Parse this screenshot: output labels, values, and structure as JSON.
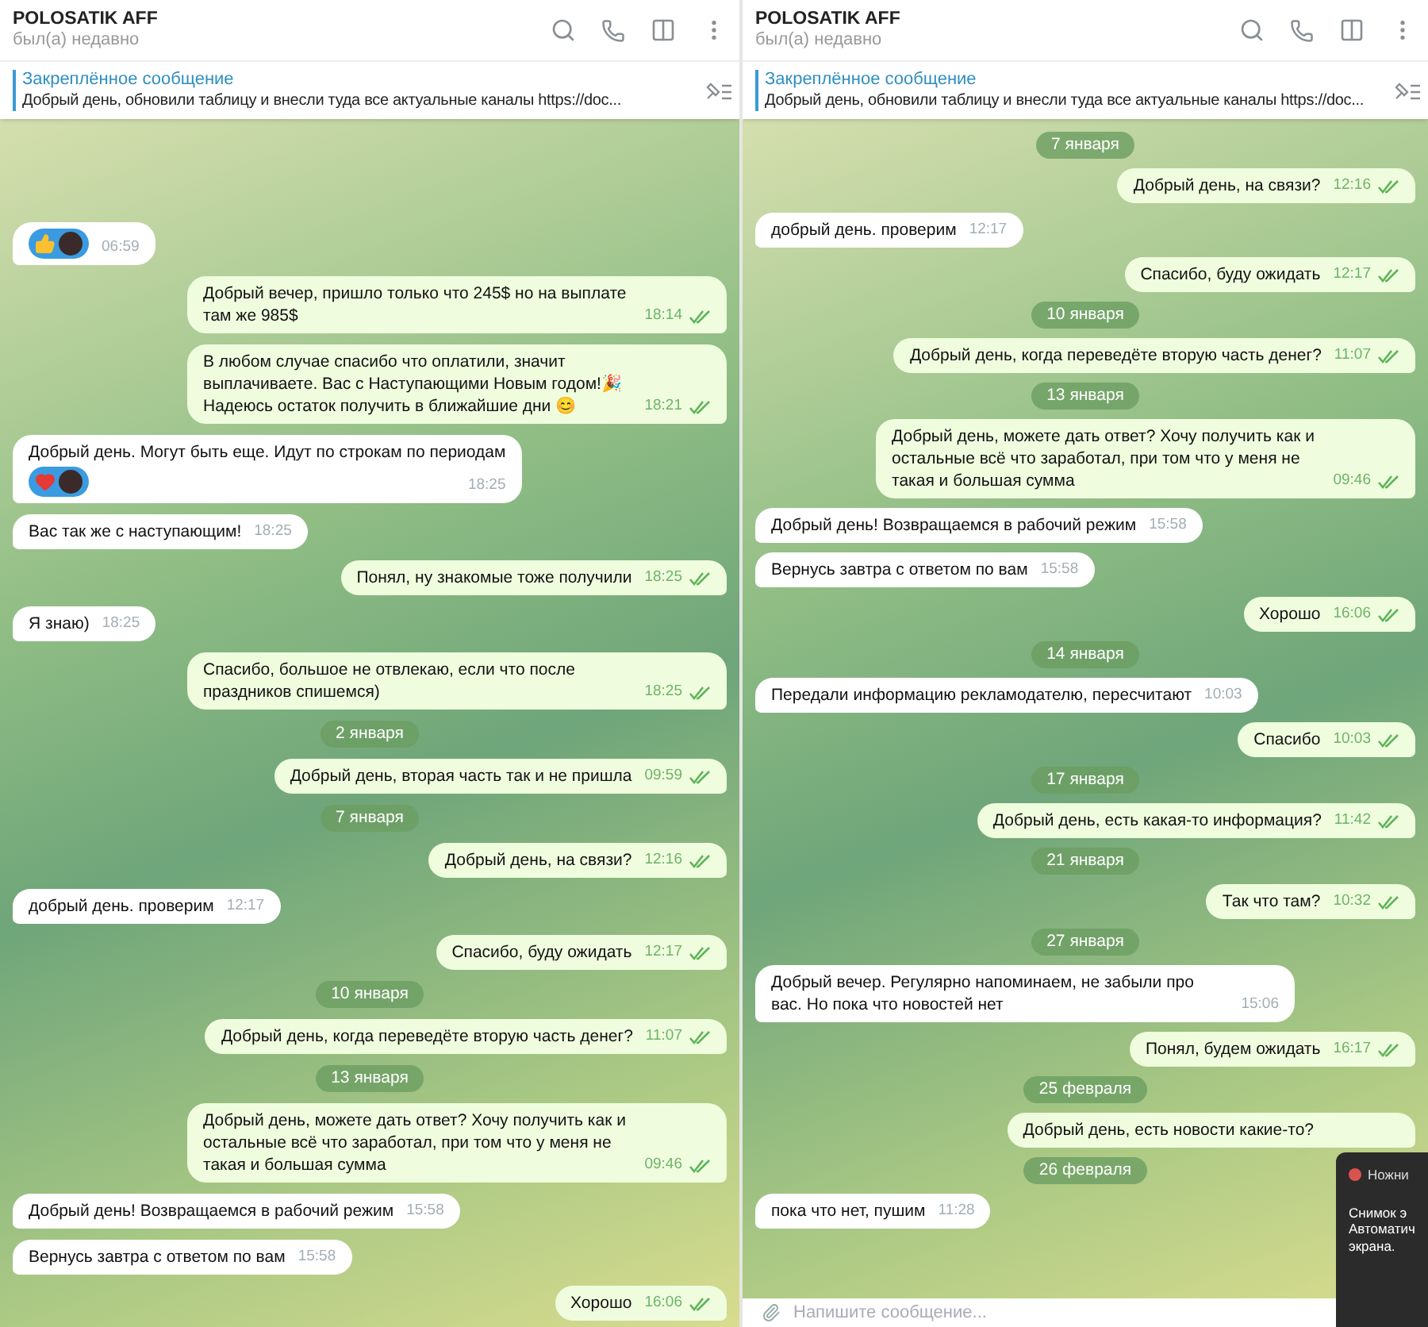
{
  "panels": [
    {
      "header": {
        "title": "POLOSATIK AFF",
        "status": "был(а) недавно"
      },
      "pinned": {
        "label": "Закреплённое сообщение",
        "text": "Добрый день, обновили таблицу и внесли туда все актуальные каналы https://doc..."
      },
      "messages": [
        {
          "kind": "in",
          "time": "06:59",
          "reactions": [
            {
              "kind": "like"
            },
            {
              "kind": "avatar"
            }
          ]
        },
        {
          "kind": "out",
          "text": "Добрый вечер, пришло только что 245$ но на выплате там же 985$",
          "time": "18:14",
          "read": true
        },
        {
          "kind": "out",
          "text": "В любом случае спасибо что оплатили, значит выплачиваете. Вас с Наступающими Новым годом!🎉\nНадеюсь остаток получить в ближайшие дни 😊",
          "time": "18:21",
          "read": true
        },
        {
          "kind": "in",
          "text": "Добрый день. Могут быть еще. Идут по строкам по периодам",
          "time": "18:25",
          "reactions": [
            {
              "kind": "heart"
            },
            {
              "kind": "avatar"
            }
          ]
        },
        {
          "kind": "in",
          "text": "Вас так же с наступающим!",
          "time": "18:25"
        },
        {
          "kind": "out",
          "text": "Понял, ну знакомые тоже получили",
          "time": "18:25",
          "read": true
        },
        {
          "kind": "in",
          "text": "Я знаю)",
          "time": "18:25"
        },
        {
          "kind": "out",
          "text": "Спасибо, большое не отвлекаю, если что после праздников спишемся)",
          "time": "18:25",
          "read": true
        },
        {
          "kind": "date",
          "text": "2 января"
        },
        {
          "kind": "out",
          "text": "Добрый день, вторая часть так и не пришла",
          "time": "09:59",
          "read": true
        },
        {
          "kind": "date",
          "text": "7 января"
        },
        {
          "kind": "out",
          "text": "Добрый день, на связи?",
          "time": "12:16",
          "read": true
        },
        {
          "kind": "in",
          "text": "добрый день. проверим",
          "time": "12:17"
        },
        {
          "kind": "out",
          "text": "Спасибо, буду ожидать",
          "time": "12:17",
          "read": true
        },
        {
          "kind": "date",
          "text": "10 января"
        },
        {
          "kind": "out",
          "text": "Добрый день, когда переведёте вторую часть денег?",
          "time": "11:07",
          "read": true
        },
        {
          "kind": "date",
          "text": "13 января"
        },
        {
          "kind": "out",
          "text": "Добрый день, можете дать ответ? Хочу получить как и остальные всё что заработал, при том что у меня не такая и большая сумма",
          "time": "09:46",
          "read": true
        },
        {
          "kind": "in",
          "text": "Добрый день! Возвращаемся в рабочий режим",
          "time": "15:58"
        },
        {
          "kind": "in",
          "text": "Вернусь завтра с ответом по вам",
          "time": "15:58"
        },
        {
          "kind": "out",
          "text": "Хорошо",
          "time": "16:06",
          "read": true
        }
      ]
    },
    {
      "header": {
        "title": "POLOSATIK AFF",
        "status": "был(а) недавно"
      },
      "pinned": {
        "label": "Закреплённое сообщение",
        "text": "Добрый день, обновили таблицу и внесли туда все актуальные каналы https://doc..."
      },
      "messages": [
        {
          "kind": "date",
          "text": "7 января"
        },
        {
          "kind": "out",
          "text": "Добрый день, на связи?",
          "time": "12:16",
          "read": true
        },
        {
          "kind": "in",
          "text": "добрый день. проверим",
          "time": "12:17"
        },
        {
          "kind": "out",
          "text": "Спасибо, буду ожидать",
          "time": "12:17",
          "read": true
        },
        {
          "kind": "date",
          "text": "10 января"
        },
        {
          "kind": "out",
          "text": "Добрый день, когда переведёте вторую часть денег?",
          "time": "11:07",
          "read": true
        },
        {
          "kind": "date",
          "text": "13 января"
        },
        {
          "kind": "out",
          "text": "Добрый день, можете дать ответ? Хочу получить как и остальные всё что заработал, при том что у меня не такая и большая сумма",
          "time": "09:46",
          "read": true
        },
        {
          "kind": "in",
          "text": "Добрый день! Возвращаемся в рабочий режим",
          "time": "15:58"
        },
        {
          "kind": "in",
          "text": "Вернусь завтра с ответом по вам",
          "time": "15:58"
        },
        {
          "kind": "out",
          "text": "Хорошо",
          "time": "16:06",
          "read": true
        },
        {
          "kind": "date",
          "text": "14 января"
        },
        {
          "kind": "in",
          "text": "Передали информацию рекламодателю, пересчитают",
          "time": "10:03"
        },
        {
          "kind": "out",
          "text": "Спасибо",
          "time": "10:03",
          "read": true
        },
        {
          "kind": "date",
          "text": "17 января"
        },
        {
          "kind": "out",
          "text": "Добрый день, есть какая-то информация?",
          "time": "11:42",
          "read": true
        },
        {
          "kind": "date",
          "text": "21 января"
        },
        {
          "kind": "out",
          "text": "Так что там?",
          "time": "10:32",
          "read": true
        },
        {
          "kind": "date",
          "text": "27 января"
        },
        {
          "kind": "in",
          "text": "Добрый вечер. Регулярно напоминаем, не забыли про вас. Но пока что новостей нет",
          "time": "15:06"
        },
        {
          "kind": "out",
          "text": "Понял, будем ожидать",
          "time": "16:17",
          "read": true
        },
        {
          "kind": "date",
          "text": "25 февраля"
        },
        {
          "kind": "out",
          "text": "Добрый день, есть новости какие-то?"
        },
        {
          "kind": "date",
          "text": "26 февраля"
        },
        {
          "kind": "in",
          "text": "пока что нет, пушим",
          "time": "11:28"
        }
      ],
      "composer": {
        "placeholder": "Напишите сообщение..."
      },
      "notification": {
        "title": "Ножни",
        "lines": [
          "Снимок э",
          "Автоматич",
          "экрана."
        ]
      }
    }
  ]
}
